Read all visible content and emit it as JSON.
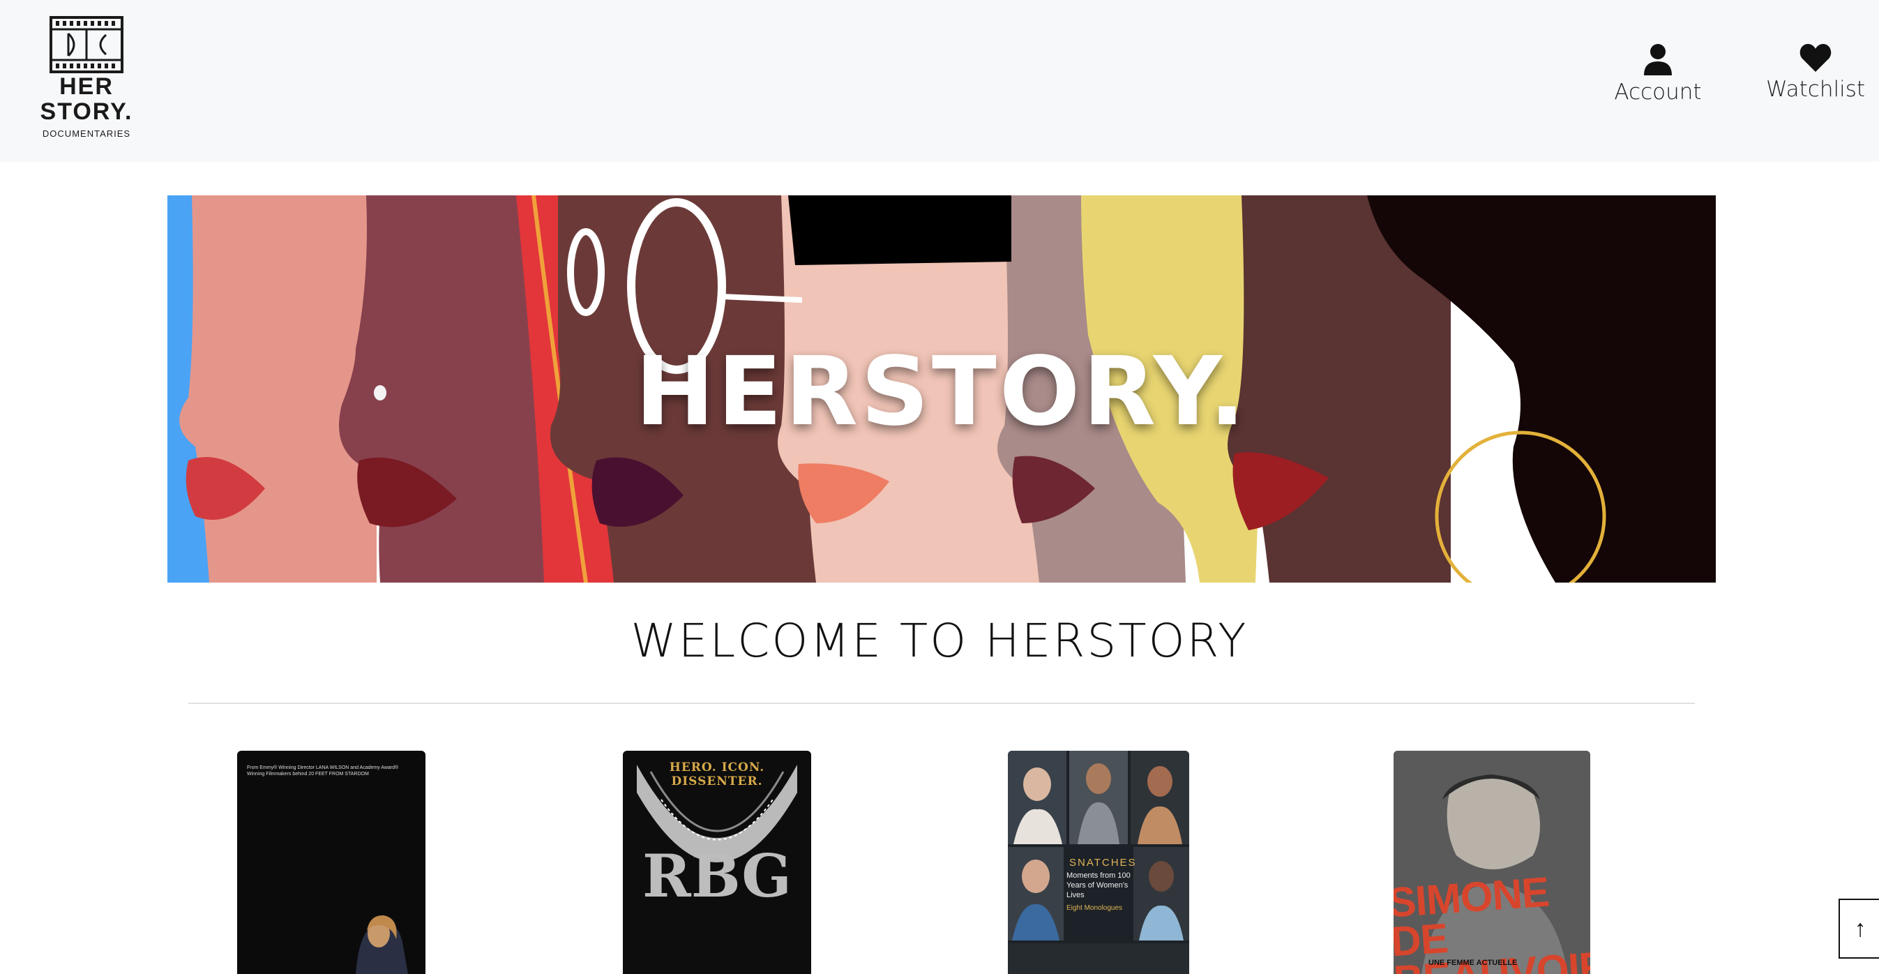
{
  "header": {
    "logo": {
      "line1": "HER",
      "line2": "STORY.",
      "subtitle": "DOCUMENTARIES",
      "film_mark": "DC"
    },
    "nav": [
      {
        "label": "Account",
        "icon": "user-icon"
      },
      {
        "label": "Watchlist",
        "icon": "heart-icon"
      }
    ]
  },
  "hero": {
    "title": "HERSTORY."
  },
  "main": {
    "heading": "WELCOME TO HERSTORY",
    "posters": [
      {
        "tagline": "From Emmy® Winning Director LANA WILSON and Academy Award® Winning Filmmakers behind 20 FEET FROM STARDOM"
      },
      {
        "tagline": "HERO. ICON. DISSENTER.",
        "title": "RBG"
      },
      {
        "title": "SNATCHES",
        "subtitle": "Moments from 100 Years of Women's Lives",
        "note": "Eight Monologues"
      },
      {
        "title": "SIMONE DE BEAUVOIR",
        "subtitle": "UNE FEMME ACTUELLE"
      }
    ]
  },
  "back_to_top": {
    "icon": "arrow-up-icon",
    "glyph": "↑"
  },
  "colors": {
    "header_bg": "#f7f8fa",
    "divider": "#e1e1e1",
    "poster_accent_gold": "#d6a94a",
    "poster_accent_red": "#d8452d"
  }
}
